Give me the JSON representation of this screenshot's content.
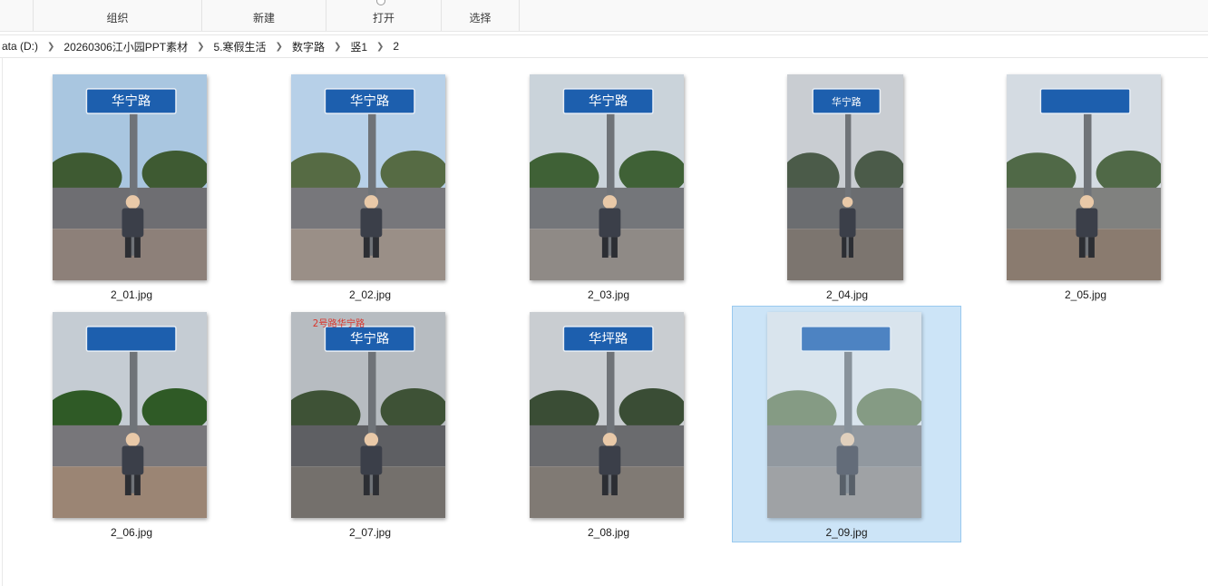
{
  "ribbon": {
    "groups": [
      {
        "label": "组织"
      },
      {
        "label": "新建"
      },
      {
        "label": "打开"
      },
      {
        "label": "选择"
      }
    ]
  },
  "breadcrumb": {
    "items": [
      "ata (D:)",
      "20260306江小园PPT素材",
      "5.寒假生活",
      "数字路",
      "竖1",
      "2"
    ]
  },
  "files": [
    {
      "name": "2_01.jpg",
      "sign": "华宁路",
      "selected": false
    },
    {
      "name": "2_02.jpg",
      "sign": "华宁路",
      "selected": false
    },
    {
      "name": "2_03.jpg",
      "sign": "华宁路",
      "selected": false
    },
    {
      "name": "2_04.jpg",
      "sign": "华宁路",
      "selected": false
    },
    {
      "name": "2_05.jpg",
      "sign": "",
      "selected": false
    },
    {
      "name": "2_06.jpg",
      "sign": "",
      "selected": false
    },
    {
      "name": "2_07.jpg",
      "sign": "华宁路",
      "caption": "2号路华宁路",
      "selected": false
    },
    {
      "name": "2_08.jpg",
      "sign": "华坪路",
      "selected": false
    },
    {
      "name": "2_09.jpg",
      "sign": "",
      "selected": true
    }
  ],
  "colors": {
    "selection_fill": "#cce4f7",
    "selection_border": "#99c9ef",
    "sign_blue": "#1d5fae"
  }
}
